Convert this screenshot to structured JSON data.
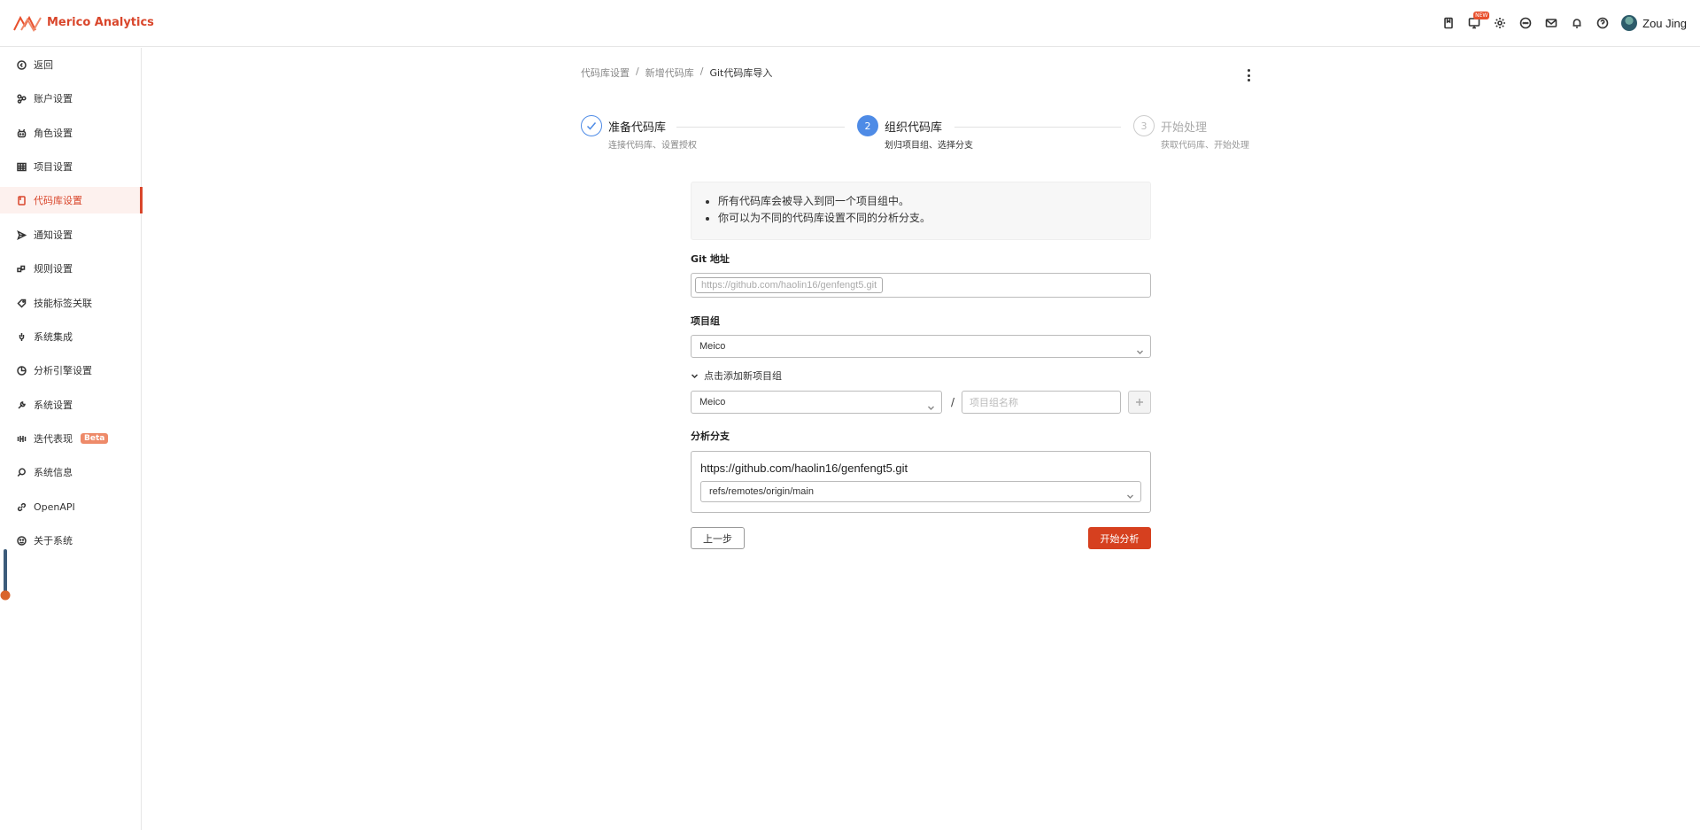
{
  "header": {
    "brand_name": "Merico Analytics",
    "new_badge": "NEW",
    "user_name": "Zou Jing",
    "icons": [
      "book-icon",
      "monitor-icon",
      "gear-icon",
      "chat-icon",
      "mail-icon",
      "bell-icon",
      "help-icon"
    ]
  },
  "sidebar": {
    "items": [
      {
        "label": "返回",
        "icon": "back-icon"
      },
      {
        "label": "账户设置",
        "icon": "account-icon"
      },
      {
        "label": "角色设置",
        "icon": "role-icon"
      },
      {
        "label": "项目设置",
        "icon": "project-icon"
      },
      {
        "label": "代码库设置",
        "icon": "repo-icon",
        "active": true
      },
      {
        "label": "通知设置",
        "icon": "send-icon"
      },
      {
        "label": "规则设置",
        "icon": "rule-icon"
      },
      {
        "label": "技能标签关联",
        "icon": "tag-icon"
      },
      {
        "label": "系统集成",
        "icon": "integration-icon"
      },
      {
        "label": "分析引擎设置",
        "icon": "engine-icon"
      },
      {
        "label": "系统设置",
        "icon": "wrench-icon"
      },
      {
        "label": "迭代表现",
        "icon": "iteration-icon",
        "badge": "Beta"
      },
      {
        "label": "系统信息",
        "icon": "info-icon"
      },
      {
        "label": "OpenAPI",
        "icon": "api-icon"
      },
      {
        "label": "关于系统",
        "icon": "about-icon"
      }
    ]
  },
  "breadcrumb": [
    "代码库设置",
    "新增代码库",
    "Git代码库导入"
  ],
  "steps": [
    {
      "number": "1",
      "title": "准备代码库",
      "desc": "连接代码库、设置授权",
      "state": "done"
    },
    {
      "number": "2",
      "title": "组织代码库",
      "desc": "划归项目组、选择分支",
      "state": "current"
    },
    {
      "number": "3",
      "title": "开始处理",
      "desc": "获取代码库、开始处理",
      "state": "todo"
    }
  ],
  "notice": [
    "所有代码库会被导入到同一个项目组中。",
    "你可以为不同的代码库设置不同的分析分支。"
  ],
  "form": {
    "git_label": "Git 地址",
    "git_url": "https://github.com/haolin16/genfengt5.git",
    "project_group_label": "项目组",
    "project_group_value": "Meico",
    "add_group_toggle": "点击添加新项目组",
    "parent_group_value": "Meico",
    "group_name_placeholder": "项目组名称",
    "branch_label": "分析分支",
    "branch_repo": "https://github.com/haolin16/genfengt5.git",
    "branch_value": "refs/remotes/origin/main"
  },
  "buttons": {
    "prev": "上一步",
    "start": "开始分析"
  },
  "colors": {
    "brand": "#d9462b",
    "primary_step": "#4e8be6",
    "start_button": "#d6401f"
  }
}
